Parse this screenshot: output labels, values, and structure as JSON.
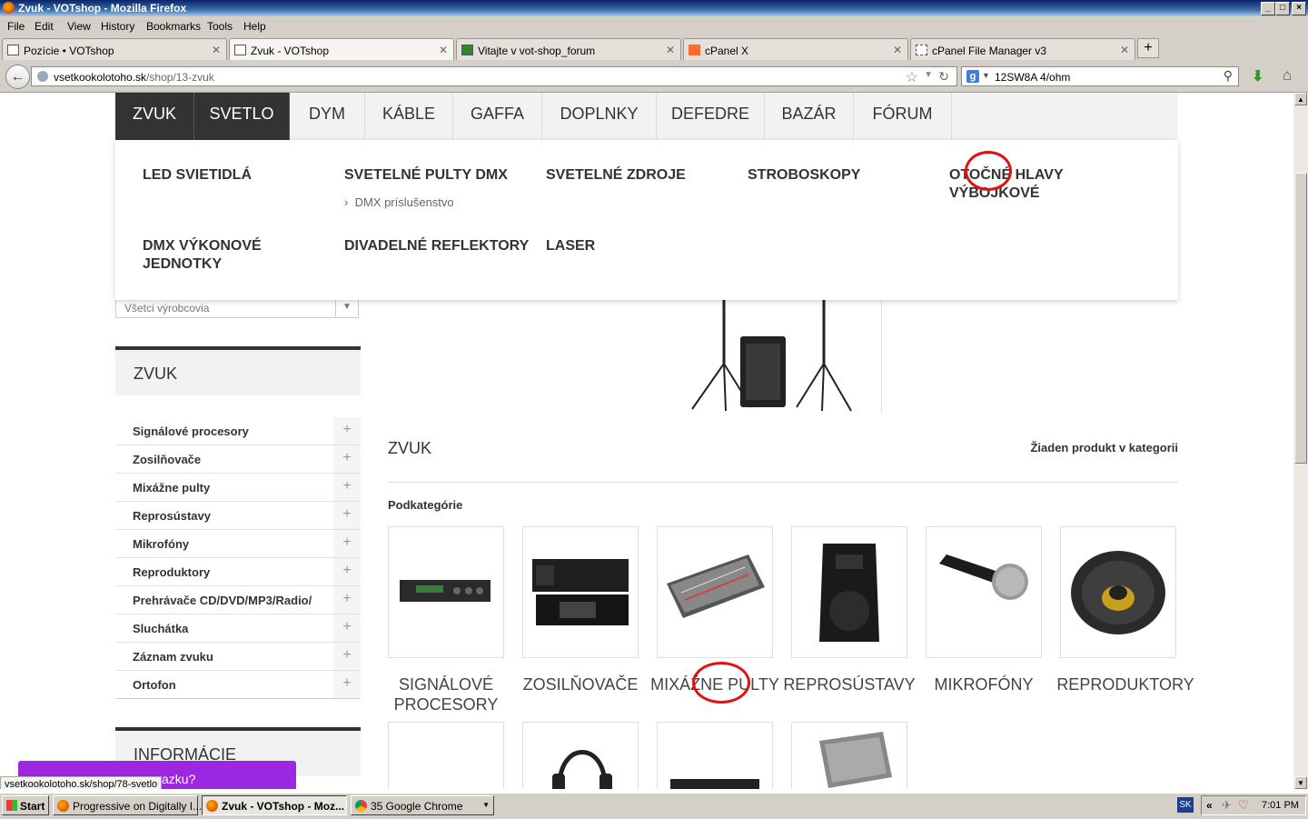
{
  "window": {
    "title": "Zvuk - VOTshop - Mozilla Firefox",
    "controls": [
      "_",
      "□",
      "×"
    ]
  },
  "menubar": [
    "File",
    "Edit",
    "View",
    "History",
    "Bookmarks",
    "Tools",
    "Help"
  ],
  "tabs": [
    {
      "label": "Pozície • VOTshop",
      "active": false
    },
    {
      "label": "Zvuk - VOTshop",
      "active": true
    },
    {
      "label": "Vitajte v vot-shop_forum",
      "active": false
    },
    {
      "label": "cPanel X",
      "active": false
    },
    {
      "label": "cPanel File Manager v3",
      "active": false
    }
  ],
  "new_tab": "+",
  "nav": {
    "back": "←",
    "url_host": "vsetkookolotoho.sk",
    "url_path": "/shop/13-zvuk",
    "search_engine": "g",
    "search_value": "12SW8A 4/ohm"
  },
  "site": {
    "main_menu": [
      "ZVUK",
      "SVETLO",
      "DYM",
      "KÁBLE",
      "GAFFA",
      "DOPLNKY",
      "DEFEDRE",
      "BAZÁR",
      "FÓRUM"
    ],
    "dropdown": {
      "row1": [
        {
          "label": "LED SVIETIDLÁ",
          "sub": ""
        },
        {
          "label": "SVETELNÉ PULTY DMX",
          "sub": "DMX príslušenstvo"
        },
        {
          "label": "SVETELNÉ ZDROJE",
          "sub": ""
        },
        {
          "label": "STROBOSKOPY",
          "sub": ""
        },
        {
          "label": "OTOČNÉ HLAVY VÝBOJKOVÉ",
          "sub": ""
        }
      ],
      "row2": [
        {
          "label": "DMX VÝKONOVÉ JEDNOTKY"
        },
        {
          "label": "DIVADELNÉ REFLEKTORY"
        },
        {
          "label": "LASER"
        }
      ]
    },
    "manufacturer_select": "Všetci výrobcovia",
    "sidebar": {
      "title": "ZVUK",
      "categories": [
        "Signálové procesory",
        "Zosilňovače",
        "Mixážne pulty",
        "Reprosústavy",
        "Mikrofóny",
        "Reproduktory",
        "Prehrávače CD/DVD/MP3/Radio/",
        "Sluchátka",
        "Záznam zvuku",
        "Ortofon"
      ],
      "plus": "+",
      "info_title": "INFORMÁCIE"
    },
    "main": {
      "section_title": "ZVUK",
      "no_product": "Žiaden produkt v kategorii",
      "subcategories_label": "Podkategórie",
      "subcategories": [
        "SIGNÁLOVÉ PROCESORY",
        "ZOSILŇOVAČE",
        "MIXÁŽNE PULTY",
        "REPROSÚSTAVY",
        "MIKROFÓNY",
        "REPRODUKTORY"
      ]
    },
    "chat_widget": "azku?",
    "status_url": "vsetkookolotoho.sk/shop/78-svetlo"
  },
  "taskbar": {
    "start": "Start",
    "items": [
      {
        "label": "Progressive on Digitally I...",
        "icon": "firefox-icon",
        "active": false
      },
      {
        "label": "Zvuk - VOTshop - Moz...",
        "icon": "firefox-icon",
        "active": true
      },
      {
        "label": "35 Google Chrome",
        "icon": "chrome-icon",
        "active": false
      }
    ],
    "lang": "SK",
    "clock": "7:01 PM"
  },
  "colors": {
    "menu_dark": "#333333",
    "annotation_red": "#e41010",
    "chat_purple": "#9c27e0"
  }
}
